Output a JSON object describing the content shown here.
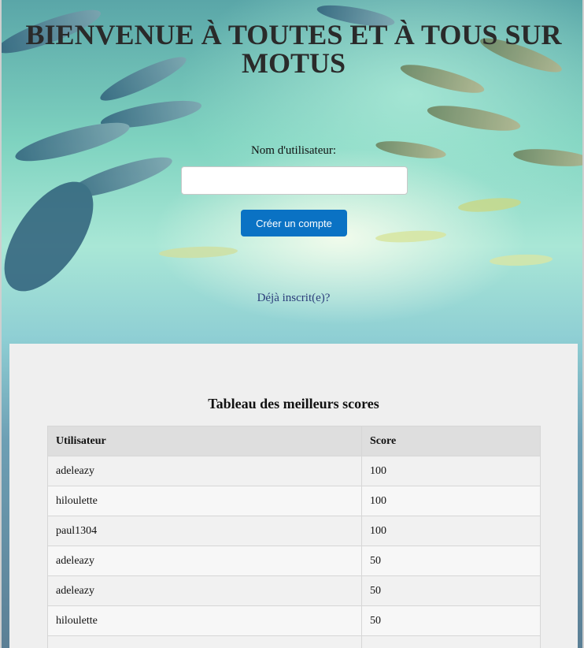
{
  "header": {
    "title": "BIENVENUE À TOUTES ET À TOUS SUR MOTUS"
  },
  "signup": {
    "username_label": "Nom d'utilisateur:",
    "username_value": "",
    "username_placeholder": "",
    "create_button": "Créer un compte",
    "login_link": "Déjà inscrit(e)?"
  },
  "leaderboard": {
    "title": "Tableau des meilleurs scores",
    "columns": [
      "Utilisateur",
      "Score"
    ],
    "rows": [
      {
        "user": "adeleazy",
        "score": "100"
      },
      {
        "user": "hiloulette",
        "score": "100"
      },
      {
        "user": "paul1304",
        "score": "100"
      },
      {
        "user": "adeleazy",
        "score": "50"
      },
      {
        "user": "adeleazy",
        "score": "50"
      },
      {
        "user": "hiloulette",
        "score": "50"
      },
      {
        "user": "",
        "score": ""
      }
    ]
  },
  "colors": {
    "button": "#0a72c4",
    "link": "#2b3d7a",
    "panel": "#efefef"
  },
  "icons": [
    "fish-school-background"
  ]
}
